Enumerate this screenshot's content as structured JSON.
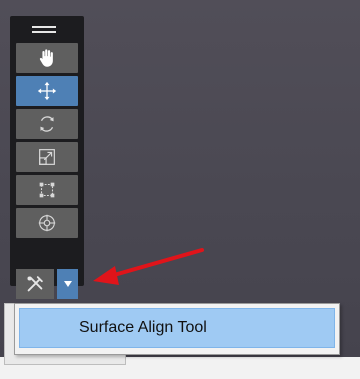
{
  "toolbar": {
    "tools": [
      {
        "name": "hand-icon",
        "active": false
      },
      {
        "name": "move-icon",
        "active": true
      },
      {
        "name": "rotate-icon",
        "active": false
      },
      {
        "name": "scale-icon",
        "active": false
      },
      {
        "name": "rect-transform-icon",
        "active": false
      },
      {
        "name": "transform-icon",
        "active": false
      }
    ],
    "flyout": {
      "icon": "surface-align-icon",
      "dropdown_icon": "dropdown-arrow-icon"
    }
  },
  "menu": {
    "items": [
      {
        "label": "Surface Align Tool",
        "highlighted": true
      }
    ]
  },
  "colors": {
    "viewport": "#4b4953",
    "toolbar": "#1c1c1f",
    "button": "#5f5f5f",
    "active": "#4e80b5",
    "menu_highlight": "#9fcaf3",
    "annotation_arrow": "#e0141a"
  }
}
